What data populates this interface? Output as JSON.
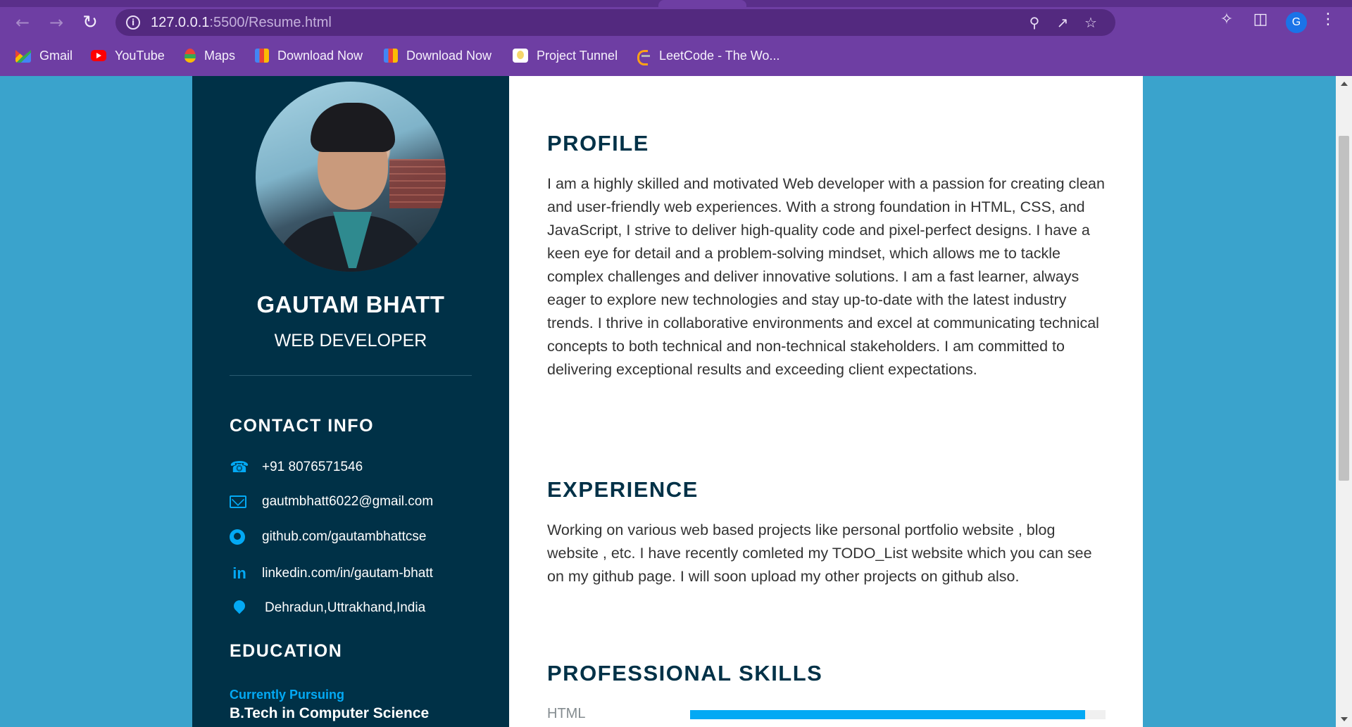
{
  "browser": {
    "url_host": "127.0.0.1",
    "url_rest": ":5500/Resume.html",
    "profile_initial": "G",
    "bookmarks": [
      {
        "label": "Gmail",
        "icon": "gmail-icon"
      },
      {
        "label": "YouTube",
        "icon": "youtube-icon"
      },
      {
        "label": "Maps",
        "icon": "maps-icon"
      },
      {
        "label": "Download Now",
        "icon": "download-icon"
      },
      {
        "label": "Download Now",
        "icon": "download-icon"
      },
      {
        "label": "Project Tunnel",
        "icon": "project-icon"
      },
      {
        "label": "LeetCode - The Wo...",
        "icon": "leetcode-icon"
      }
    ]
  },
  "sidebar": {
    "name": "GAUTAM BHATT",
    "role": "WEB DEVELOPER",
    "contact_title": "CONTACT INFO",
    "contacts": [
      {
        "icon": "phone-icon",
        "text": "+91 8076571546"
      },
      {
        "icon": "mail-icon",
        "text": "gautmbhatt6022@gmail.com"
      },
      {
        "icon": "github-icon",
        "text": "github.com/gautambhattcse"
      },
      {
        "icon": "linkedin-icon",
        "text": "linkedin.com/in/gautam-bhatt"
      },
      {
        "icon": "location-icon",
        "text": "Dehradun,Uttrakhand,India"
      }
    ],
    "education_title": "EDUCATION",
    "education": {
      "status": "Currently Pursuing",
      "degree": "B.Tech in Computer Science"
    }
  },
  "main": {
    "profile_title": "PROFILE",
    "profile_text": "I am a highly skilled and motivated Web developer with a passion for creating clean and user-friendly web experiences. With a strong foundation in HTML, CSS, and JavaScript, I strive to deliver high-quality code and pixel-perfect designs. I have a keen eye for detail and a problem-solving mindset, which allows me to tackle complex challenges and deliver innovative solutions. I am a fast learner, always eager to explore new technologies and stay up-to-date with the latest industry trends. I thrive in collaborative environments and excel at communicating technical concepts to both technical and non-technical stakeholders. I am committed to delivering exceptional results and exceeding client expectations.",
    "experience_title": "EXPERIENCE",
    "experience_text": "Working on various web based projects like personal portfolio website , blog website , etc. I have recently comleted my TODO_List website which you can see on my github page. I will soon upload my other projects on github also.",
    "skills_title": "PROFESSIONAL SKILLS",
    "skills": [
      {
        "label": "HTML",
        "level_percent": 95
      }
    ]
  },
  "colors": {
    "page_bg": "#3aa3cc",
    "sidebar_bg": "#003147",
    "accent": "#03a9f4",
    "browser_bar": "#6e3ea3"
  }
}
